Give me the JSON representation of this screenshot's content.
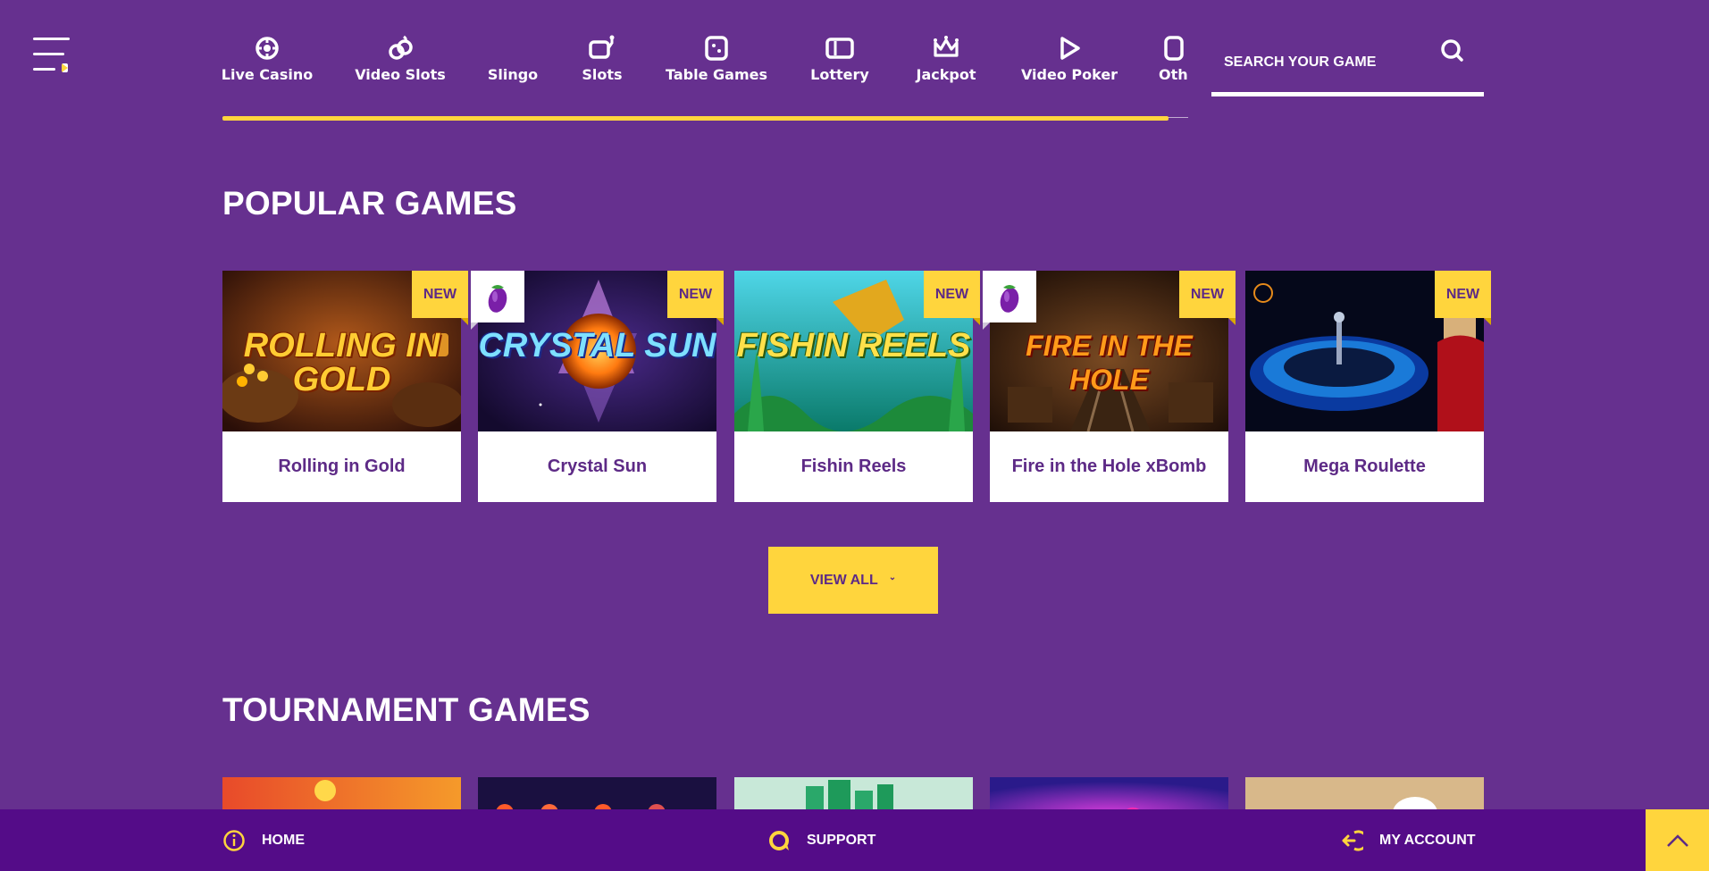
{
  "nav": {
    "items": [
      {
        "label": "Live Casino",
        "icon": "live-casino-icon"
      },
      {
        "label": "Video Slots",
        "icon": "video-slots-icon"
      },
      {
        "label": "Slingo",
        "icon": "slingo-icon"
      },
      {
        "label": "Slots",
        "icon": "slots-icon"
      },
      {
        "label": "Table Games",
        "icon": "table-games-icon"
      },
      {
        "label": "Lottery",
        "icon": "lottery-icon"
      },
      {
        "label": "Jackpot",
        "icon": "jackpot-crown-icon"
      },
      {
        "label": "Video Poker",
        "icon": "video-poker-play-icon"
      },
      {
        "label": "Oth",
        "icon": "others-icon"
      }
    ]
  },
  "search": {
    "placeholder": "SEARCH YOUR GAME"
  },
  "popular": {
    "title": "POPULAR GAMES",
    "games": [
      {
        "name": "Rolling in Gold",
        "badge": "NEW",
        "art_text": "ROLLING IN GOLD"
      },
      {
        "name": "Crystal Sun",
        "badge": "NEW",
        "art_text": "CRYSTAL SUN"
      },
      {
        "name": "Fishin Reels",
        "badge": "NEW",
        "art_text": "FISHIN REELS"
      },
      {
        "name": "Fire in the Hole xBomb",
        "badge": "NEW",
        "art_text": "FIRE IN THE HOLE"
      },
      {
        "name": "Mega Roulette",
        "badge": "NEW",
        "art_text": ""
      }
    ],
    "view_all": "VIEW ALL"
  },
  "tournament": {
    "title": "TOURNAMENT GAMES"
  },
  "bottom_bar": {
    "home": "HOME",
    "support": "SUPPORT",
    "account": "MY ACCOUNT"
  },
  "colors": {
    "background": "#66308f",
    "accent": "#ffd53d",
    "bottom_bar": "#540c88",
    "card_text": "#5d2a86"
  }
}
